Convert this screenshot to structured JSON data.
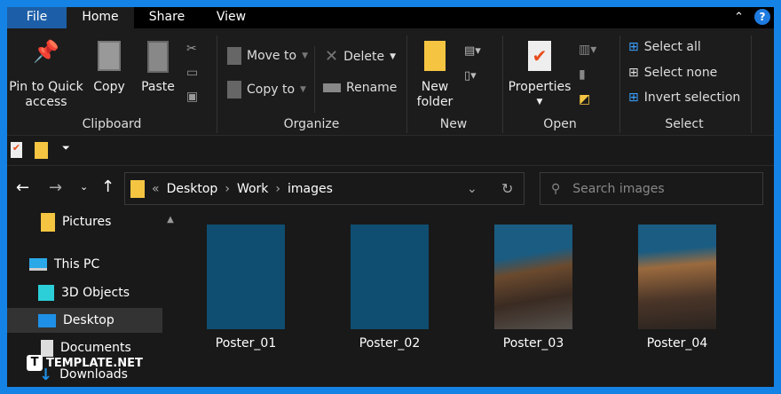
{
  "tabs": {
    "file": "File",
    "home": "Home",
    "share": "Share",
    "view": "View"
  },
  "ribbon": {
    "clipboard": {
      "label": "Clipboard",
      "pin": "Pin to Quick access",
      "pin1": "Pin to Quick",
      "pin2": "access",
      "copy": "Copy",
      "paste": "Paste"
    },
    "organize": {
      "label": "Organize",
      "move_to": "Move to",
      "copy_to": "Copy to",
      "delete": "Delete",
      "rename": "Rename"
    },
    "new": {
      "label": "New",
      "new_folder1": "New",
      "new_folder2": "folder"
    },
    "open": {
      "label": "Open",
      "properties": "Properties"
    },
    "select": {
      "label": "Select",
      "select_all": "Select all",
      "select_none": "Select none",
      "invert": "Invert selection"
    }
  },
  "address": {
    "path": [
      "Desktop",
      "Work",
      "images"
    ],
    "search_placeholder": "Search images"
  },
  "nav": {
    "items": [
      {
        "label": "Pictures"
      },
      {
        "label": "This PC"
      },
      {
        "label": "3D Objects"
      },
      {
        "label": "Desktop",
        "selected": true
      },
      {
        "label": "Documents"
      },
      {
        "label": "Downloads"
      }
    ]
  },
  "files": [
    {
      "name": "Poster_01"
    },
    {
      "name": "Poster_02"
    },
    {
      "name": "Poster_03"
    },
    {
      "name": "Poster_04"
    }
  ],
  "watermark": "TEMPLATE.NET",
  "colors": {
    "frame": "#1583e6",
    "accent": "#1c5fa8",
    "folder": "#f5c542"
  }
}
